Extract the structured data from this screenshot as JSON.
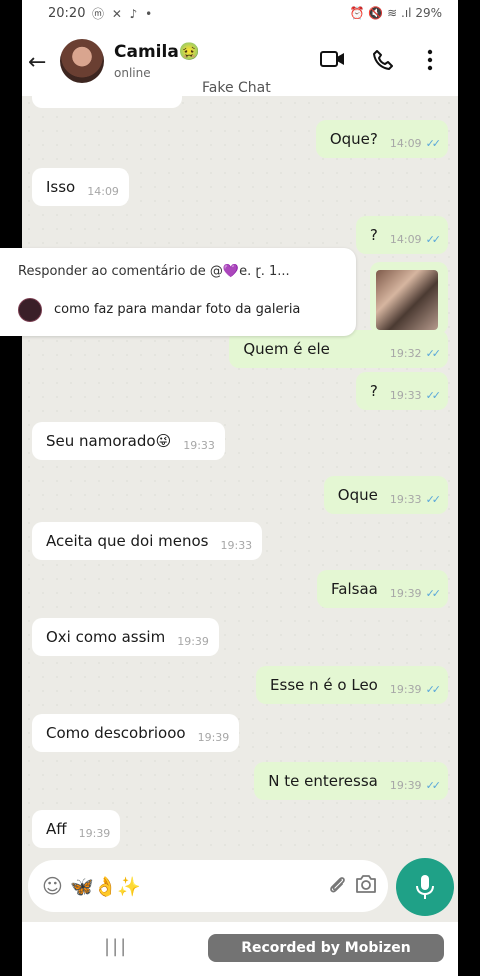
{
  "status_bar": {
    "time": "20:20",
    "left_icons": "ⓜ ✕ ♪ •",
    "right_icons": "⏰ 🔇 ≋ .ıl",
    "battery": "29%"
  },
  "header": {
    "contact_name": "Camila🤢",
    "status": "online",
    "fake_label": "Fake Chat",
    "icons": [
      "back-arrow-icon",
      "video-call-icon",
      "phone-icon",
      "more-vert-icon"
    ]
  },
  "reply_overlay": {
    "title": "Responder ao comentário de @💜e. ɽ. 1...",
    "comment": "como faz para mandar foto da galeria"
  },
  "messages": [
    {
      "text": "Oque?",
      "time": "14:09",
      "dir": "out"
    },
    {
      "text": "Isso",
      "time": "14:09",
      "dir": "in"
    },
    {
      "text": "?",
      "time": "14:09",
      "dir": "out"
    },
    {
      "text": "Quem é ele",
      "time": "19:32",
      "dir": "out"
    },
    {
      "text": "?",
      "time": "19:33",
      "dir": "out"
    },
    {
      "text": "Seu namorado😜",
      "time": "19:33",
      "dir": "in"
    },
    {
      "text": "Oque",
      "time": "19:33",
      "dir": "out"
    },
    {
      "text": "Aceita que doi menos",
      "time": "19:33",
      "dir": "in"
    },
    {
      "text": "Falsaa",
      "time": "19:39",
      "dir": "out"
    },
    {
      "text": "Oxi como assim",
      "time": "19:39",
      "dir": "in"
    },
    {
      "text": "Esse n é o Leo",
      "time": "19:39",
      "dir": "out"
    },
    {
      "text": "Como descobriooo",
      "time": "19:39",
      "dir": "in"
    },
    {
      "text": "N te enteressa",
      "time": "19:39",
      "dir": "out"
    },
    {
      "text": "Aff",
      "time": "19:39",
      "dir": "in"
    }
  ],
  "ticks": "✓✓",
  "input_bar": {
    "stickers": "🦋👌✨"
  },
  "watermark": "Recorded by Mobizen",
  "nav": {
    "recents": "|||"
  },
  "colors": {
    "incoming_bubble": "#ffffff",
    "outgoing_bubble": "#e4f7d3",
    "accent": "#1fa187",
    "tick": "#5aa7d9"
  }
}
